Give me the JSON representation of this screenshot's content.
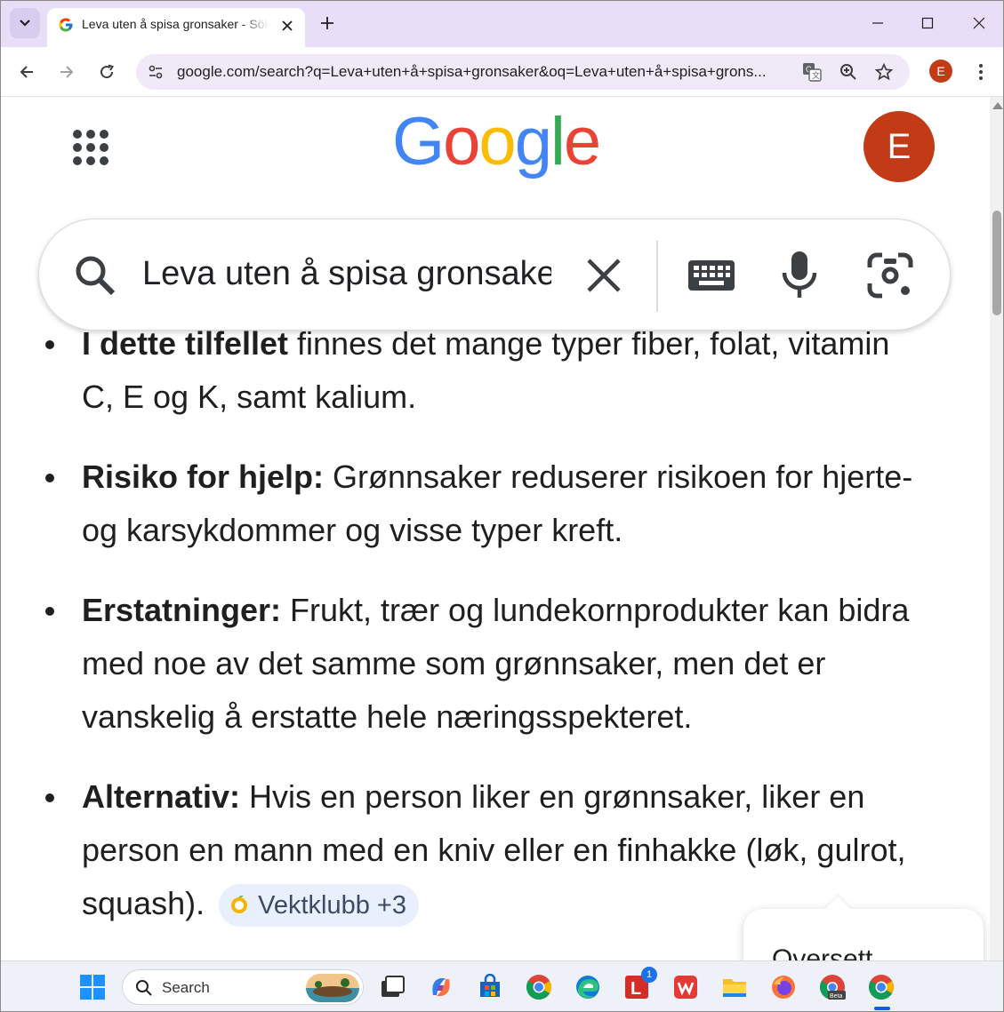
{
  "browser": {
    "tab": {
      "title": "Leva uten å spisa gronsaker - Sök",
      "favicon": "google-g-icon"
    },
    "url": "google.com/search?q=Leva+uten+å+spisa+gronsaker&oq=Leva+uten+å+spisa+grons...",
    "profile_initial": "E"
  },
  "page": {
    "logo_text": "Google",
    "avatar_initial": "E",
    "search_query": "Leva uten å spisa gronsaker"
  },
  "bullets": [
    {
      "bold": "I dette tilfellet",
      "text": " finnes det mange typer fiber, folat, vitamin C, E og K, samt kalium."
    },
    {
      "bold": "Risiko for hjelp:",
      "text": " Grønnsaker reduserer risikoen for hjerte- og karsykdommer og visse typer kreft."
    },
    {
      "bold": "Erstatninger:",
      "text": " Frukt, trær og lundekornprodukter kan bidra med noe av det samme som grønnsaker, men det er vanskelig å erstatte hele næringsspekteret."
    },
    {
      "bold": "Alternativ:",
      "text": " Hvis en person liker en grønnsaker, liker en person en mann med en kniv eller en finhakke (løk, gulrot, squash).",
      "chip": "Vektklubb +3"
    }
  ],
  "translate_popup": {
    "label": "Oversett"
  },
  "taskbar": {
    "search_label": "Search",
    "apps": [
      "windows-start-icon",
      "task-view-icon",
      "copilot-icon",
      "microsoft-store-icon",
      "chrome-icon",
      "edge-icon",
      "lastpass-icon",
      "wps-office-icon",
      "file-explorer-icon",
      "firefox-icon",
      "chrome-beta-icon",
      "chrome-active-icon"
    ],
    "badge_count": "1",
    "beta_label": "Beta"
  },
  "colors": {
    "tab_strip": "#e8def8",
    "omnibox": "#efe9f8",
    "avatar": "#c23b16",
    "chip_bg": "#e8f0fe"
  }
}
